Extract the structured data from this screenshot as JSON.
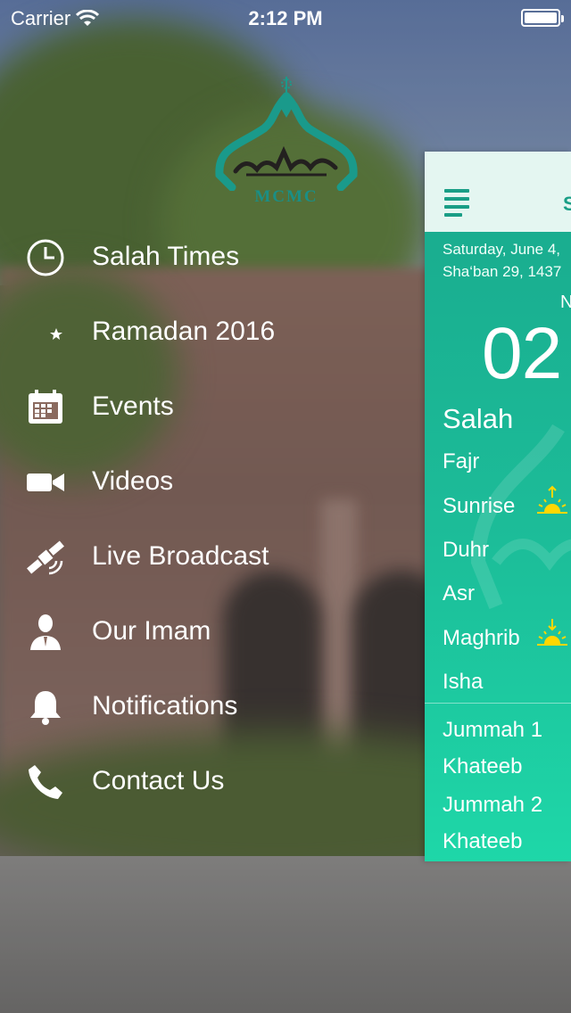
{
  "status_bar": {
    "carrier": "Carrier",
    "time": "2:12 PM",
    "wifi_icon": "wifi-icon",
    "battery_icon": "battery-icon"
  },
  "logo": {
    "text": "MCMC",
    "color": "#1a9a8b"
  },
  "menu": {
    "items": [
      {
        "label": "Salah Times",
        "icon": "clock-icon"
      },
      {
        "label": "Ramadan 2016",
        "icon": "crescent-star-icon"
      },
      {
        "label": "Events",
        "icon": "calendar-icon"
      },
      {
        "label": "Videos",
        "icon": "video-camera-icon"
      },
      {
        "label": "Live Broadcast",
        "icon": "satellite-icon"
      },
      {
        "label": "Our Imam",
        "icon": "person-icon"
      },
      {
        "label": "Notifications",
        "icon": "bell-icon"
      },
      {
        "label": "Contact Us",
        "icon": "phone-icon"
      }
    ]
  },
  "panel": {
    "title_partial": "S",
    "date_gregorian": "Saturday, June 4,",
    "date_hijri": "Sha‘ban 29, 1437",
    "next_label_partial": "N",
    "countdown_partial": "02",
    "salah_header": "Salah",
    "prayers": [
      "Fajr",
      "Sunrise",
      "Duhr",
      "Asr",
      "Maghrib",
      "Isha"
    ],
    "jummah": [
      "Jummah 1",
      "Khateeb",
      "Jummah 2",
      "Khateeb"
    ],
    "colors": {
      "accent": "#199e86",
      "panel_top": "#19a98d",
      "panel_bottom": "#1ed7a8",
      "sun": "#ffd700"
    }
  }
}
